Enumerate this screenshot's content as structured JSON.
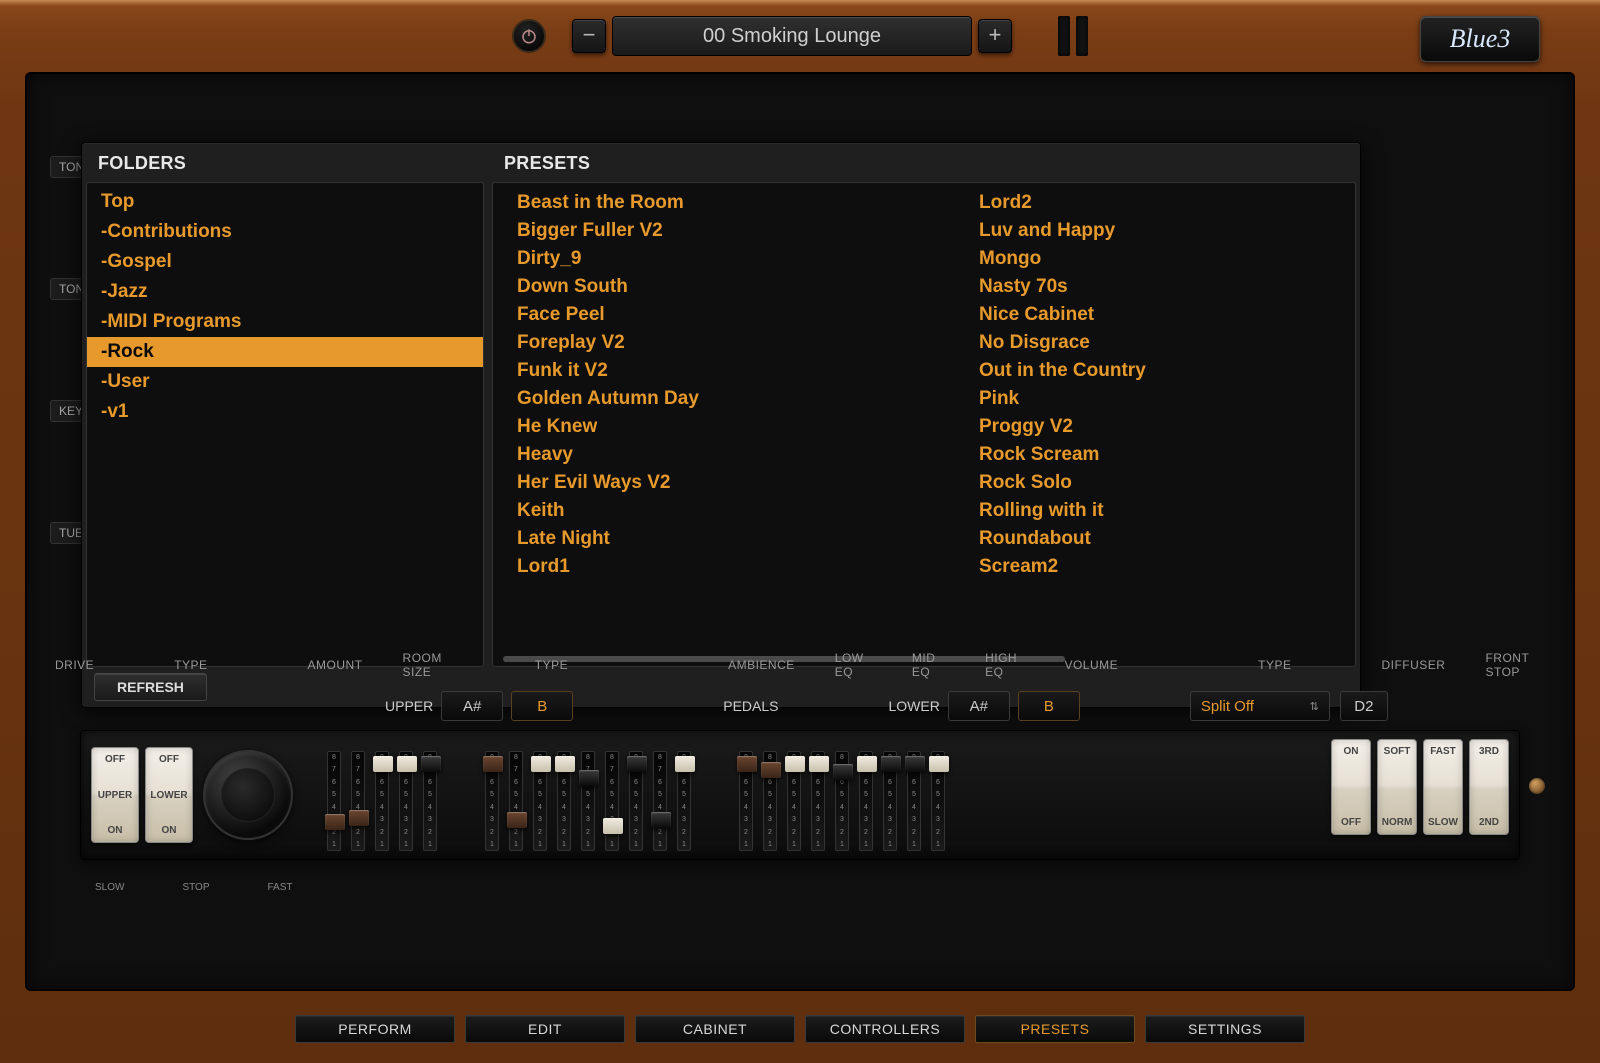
{
  "brand": "Blue3",
  "preset_display": "00 Smoking Lounge",
  "browser": {
    "folders_header": "FOLDERS",
    "presets_header": "PRESETS",
    "refresh_label": "REFRESH",
    "selected_folder_index": 5,
    "folders": [
      "Top",
      "-Contributions",
      "-Gospel",
      "-Jazz",
      "-MIDI Programs",
      "-Rock",
      "-User",
      "-v1"
    ],
    "presets": [
      "Beast in the Room",
      "Bigger Fuller V2",
      "Dirty_9",
      "Down South",
      "Face Peel",
      "Foreplay V2",
      "Funk it V2",
      "Golden Autumn Day",
      "He Knew",
      "Heavy",
      "Her Evil Ways V2",
      "Keith",
      "Late Night",
      "Lord1",
      "Lord2",
      "Luv and Happy",
      "Mongo",
      "Nasty 70s",
      "Nice Cabinet",
      "No Disgrace",
      "Out in the Country",
      "Pink",
      "Proggy V2",
      "Rock Scream",
      "Rock Solo",
      "Rolling with it",
      "Roundabout",
      "Scream2"
    ]
  },
  "side_tags": {
    "t0": "TON",
    "t1": "TON",
    "t2": "KEY",
    "t3": "TUE"
  },
  "chrome_labels": {
    "drive": "DRIVE",
    "type": "TYPE",
    "amount": "AMOUNT",
    "roomsize": "ROOM SIZE",
    "type2": "TYPE",
    "ambience": "AMBIENCE",
    "loweq": "LOW EQ",
    "mideq": "MID EQ",
    "higheq": "HIGH EQ",
    "volume": "VOLUME",
    "type3": "TYPE",
    "diffuser": "DIFFUSER",
    "frontstop": "FRONT STOP"
  },
  "keyboard_row": {
    "upper_label": "UPPER",
    "pedals_label": "PEDALS",
    "lower_label": "LOWER",
    "note_a": "A#",
    "note_b": "B",
    "split_value": "Split Off",
    "split_note": "D2"
  },
  "rockers_left": {
    "r0": {
      "top": "OFF",
      "mid": "UPPER",
      "bot": "ON"
    },
    "r1": {
      "top": "OFF",
      "mid": "LOWER",
      "bot": "ON"
    }
  },
  "rockers_right": {
    "r0": {
      "top": "ON",
      "bot": "OFF"
    },
    "r1": {
      "top": "SOFT",
      "bot": "NORM"
    },
    "r2": {
      "top": "FAST",
      "bot": "SLOW"
    },
    "r3": {
      "top": "3RD",
      "bot": "2ND"
    }
  },
  "speed": {
    "slow": "SLOW",
    "stop": "STOP",
    "fast": "FAST"
  },
  "nav": {
    "perform": "PERFORM",
    "edit": "EDIT",
    "cabinet": "CABINET",
    "controllers": "CONTROLLERS",
    "presets": "PRESETS",
    "settings": "SETTINGS",
    "active": "presets"
  },
  "drawbars": {
    "set_a": [
      {
        "color": "brown",
        "pos": 62
      },
      {
        "color": "brown",
        "pos": 58
      },
      {
        "color": "white",
        "pos": 4
      },
      {
        "color": "white",
        "pos": 4
      },
      {
        "color": "black",
        "pos": 4
      }
    ],
    "set_b": [
      {
        "color": "brown",
        "pos": 4
      },
      {
        "color": "brown",
        "pos": 60
      },
      {
        "color": "white",
        "pos": 4
      },
      {
        "color": "white",
        "pos": 4
      },
      {
        "color": "black",
        "pos": 18
      },
      {
        "color": "white",
        "pos": 66
      },
      {
        "color": "black",
        "pos": 4
      },
      {
        "color": "black",
        "pos": 60
      },
      {
        "color": "white",
        "pos": 4
      }
    ],
    "set_c": [
      {
        "color": "brown",
        "pos": 4
      },
      {
        "color": "brown",
        "pos": 10
      },
      {
        "color": "white",
        "pos": 4
      },
      {
        "color": "white",
        "pos": 4
      },
      {
        "color": "black",
        "pos": 12
      },
      {
        "color": "white",
        "pos": 4
      },
      {
        "color": "black",
        "pos": 4
      },
      {
        "color": "black",
        "pos": 4
      },
      {
        "color": "white",
        "pos": 4
      }
    ]
  }
}
